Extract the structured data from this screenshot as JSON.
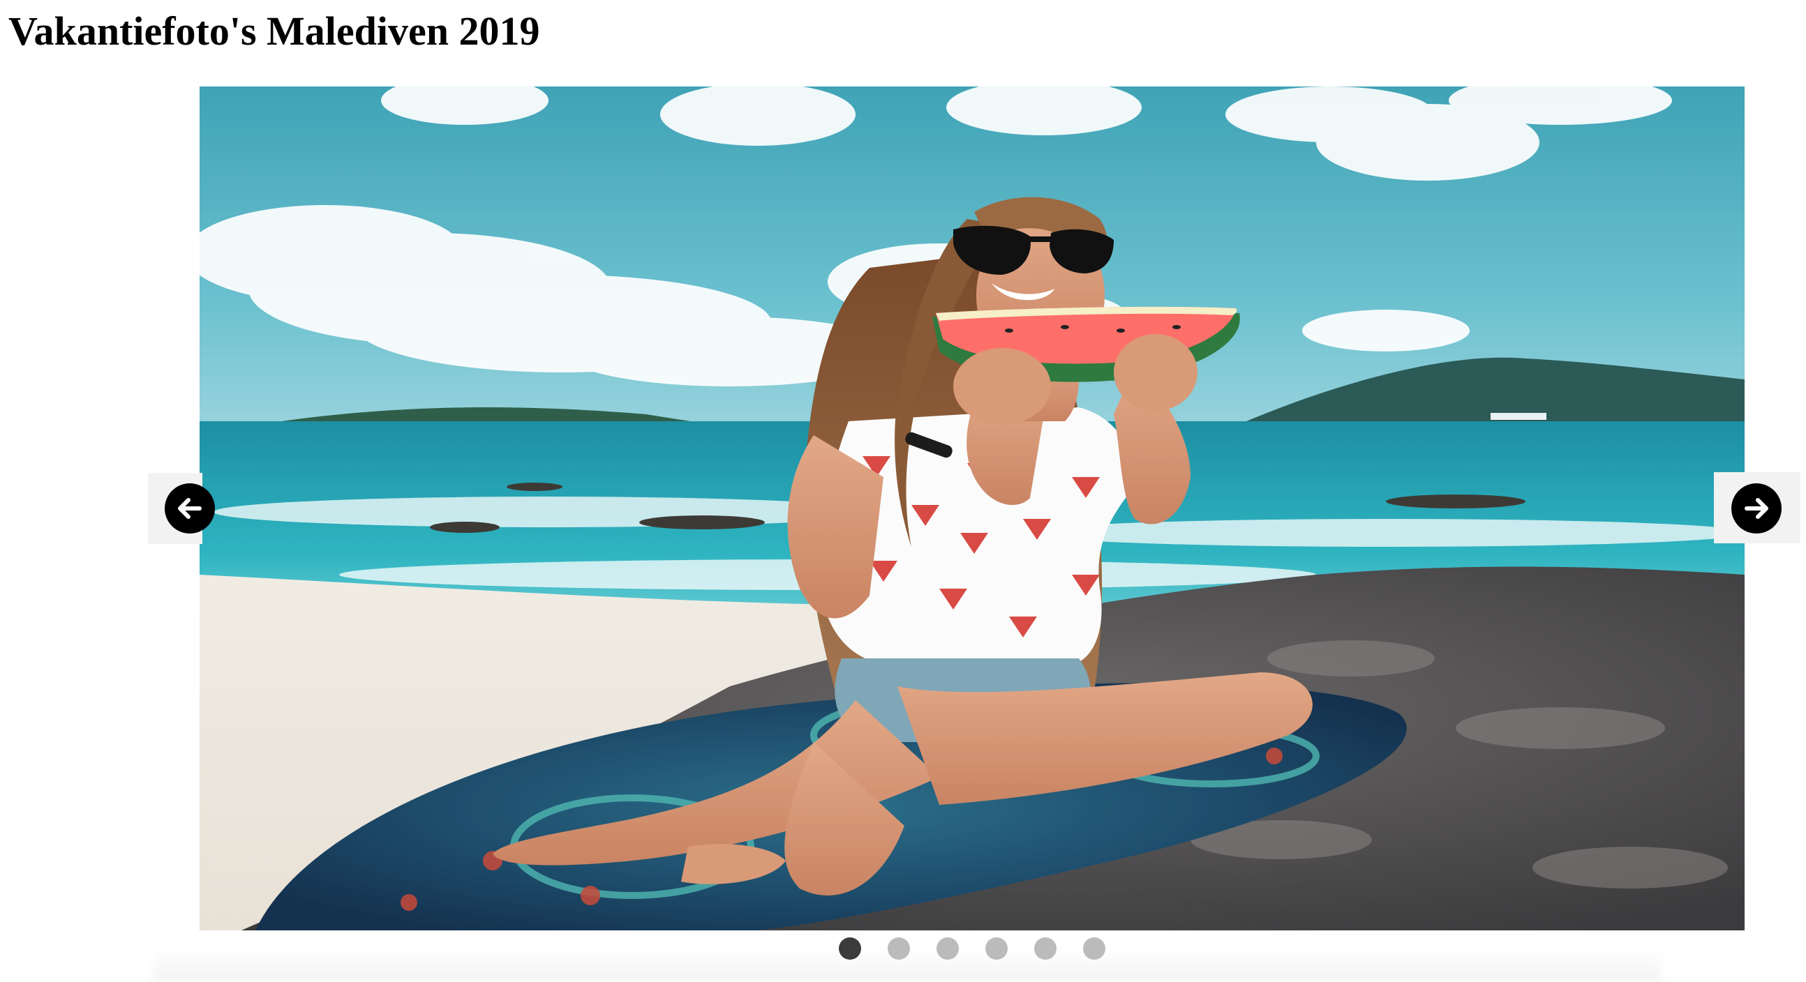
{
  "page": {
    "title": "Vakantiefoto's Malediven 2019"
  },
  "carousel": {
    "active_index": 0,
    "slide_count": 6,
    "current_slide": {
      "description_icon": "beach-photo-girl-watermelon"
    },
    "prev_icon": "arrow-left-icon",
    "next_icon": "arrow-right-icon",
    "colors": {
      "dot_active": "#3b3b3b",
      "dot_inactive": "#bbbbbb",
      "nav_background": "#f2f2f2",
      "nav_circle": "#000000"
    }
  }
}
